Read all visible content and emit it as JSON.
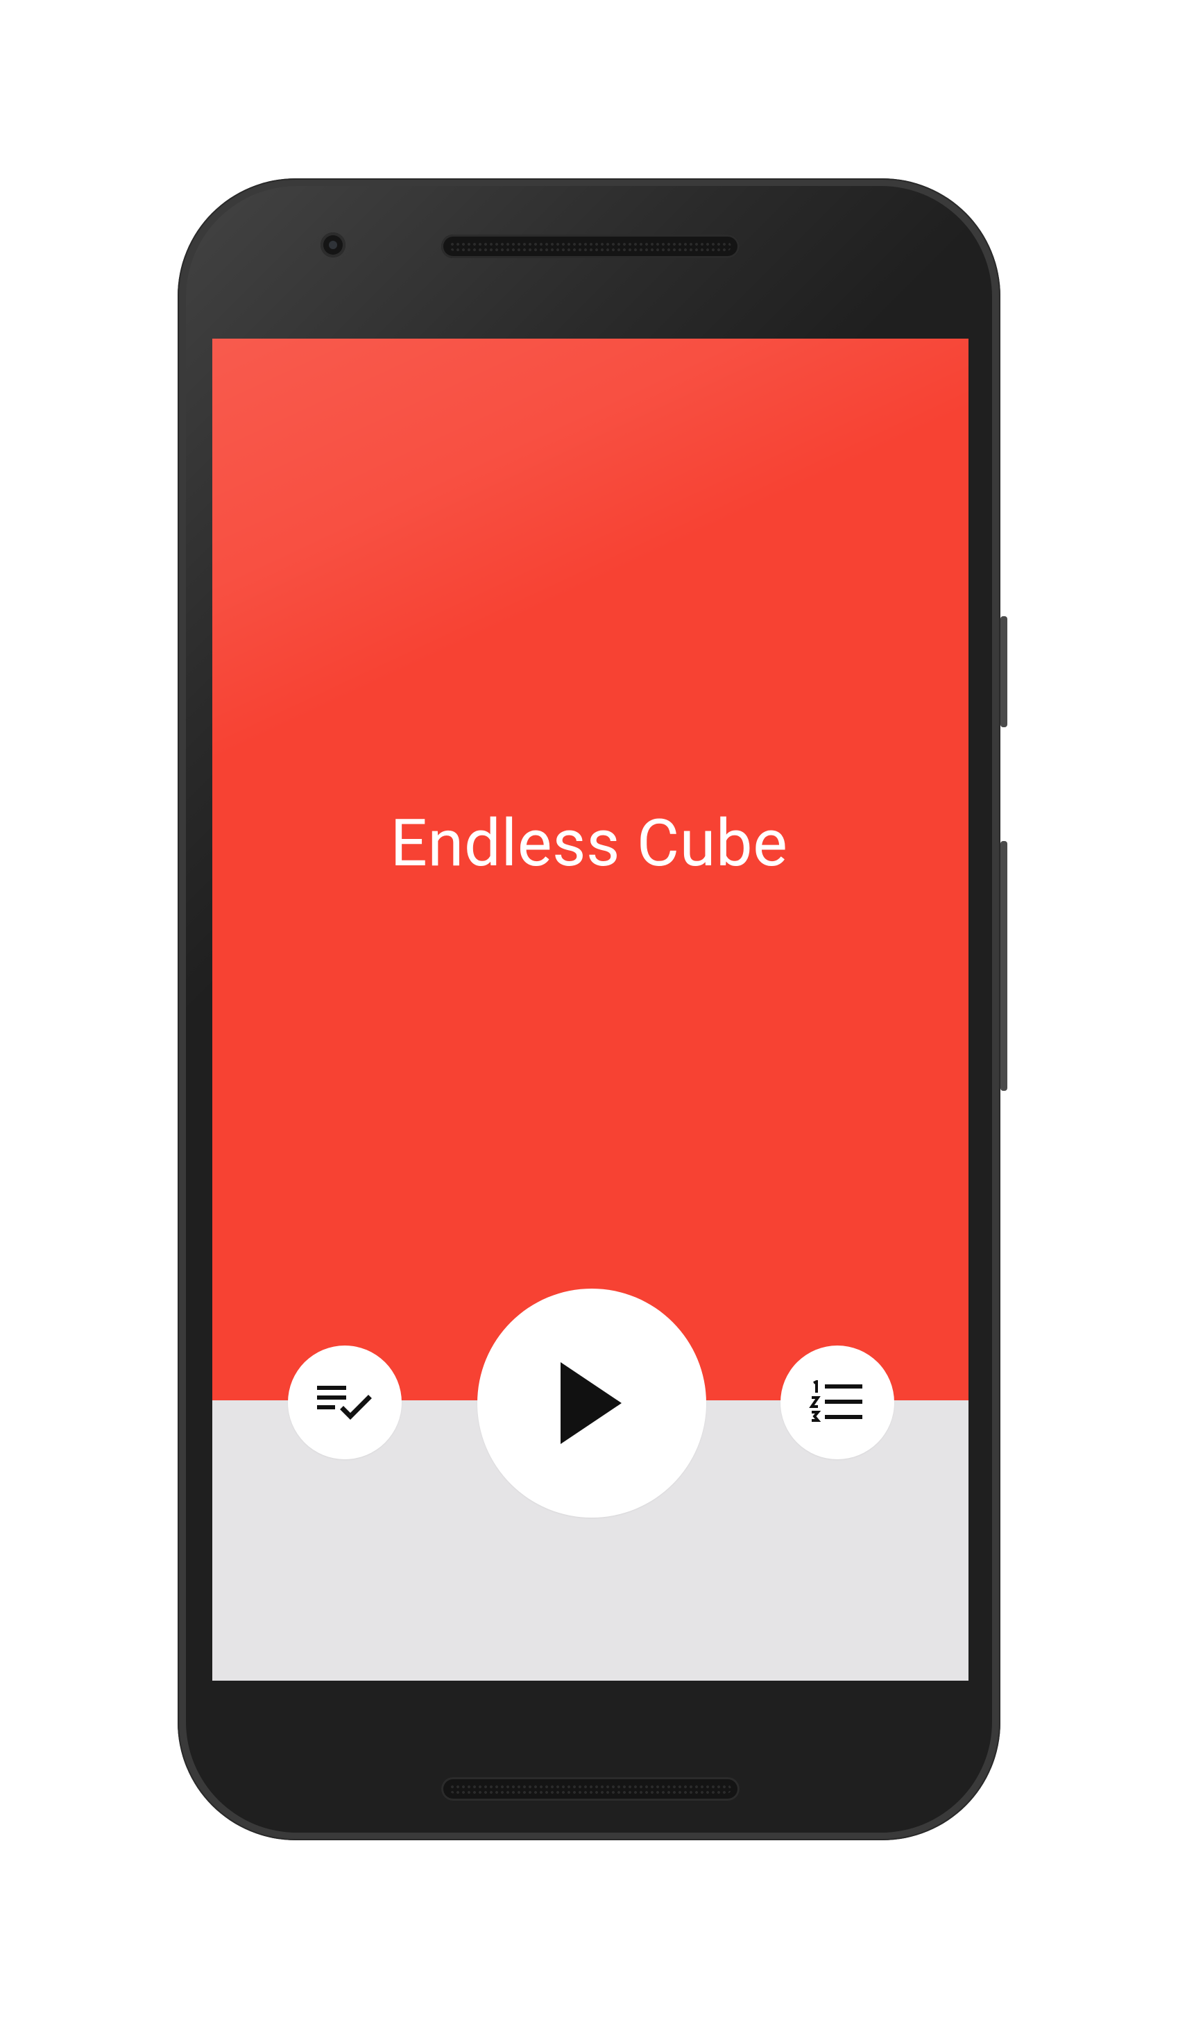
{
  "app": {
    "title": "Endless Cube"
  },
  "actions": {
    "achievements_icon": "playlist-check-icon",
    "play_icon": "play-icon",
    "leaderboard_icon": "format-list-numbered-icon"
  },
  "colors": {
    "primary": "#F74233",
    "surface": "#E5E4E6",
    "button_background": "#FFFFFF",
    "icon": "#111111",
    "title_text": "#FFFFFF",
    "device_body": "#1F1F1F"
  }
}
